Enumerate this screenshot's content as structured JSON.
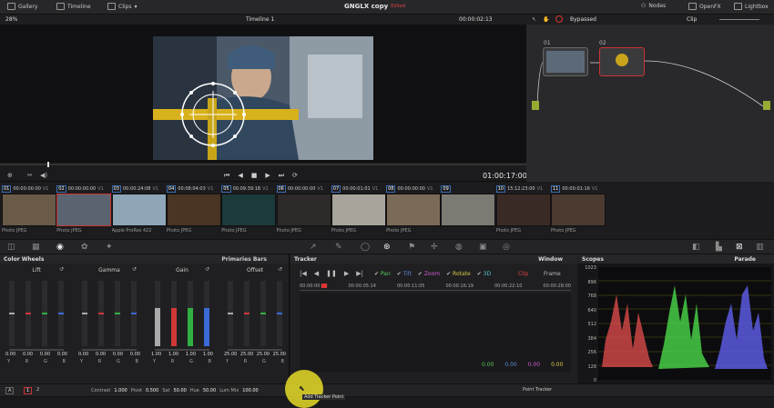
{
  "topbar": {
    "gallery": "Gallery",
    "timeline": "Timeline",
    "clips": "Clips",
    "project": "GNGLX copy",
    "edited": "Edited",
    "nodes": "Nodes",
    "openfx": "OpenFX",
    "lightbox": "Lightbox"
  },
  "viewer": {
    "zoom": "28%",
    "timeline_name": "Timeline 1",
    "timecode_top": "00:00:02:13",
    "timecode": "01:00:17:00"
  },
  "nodes": {
    "mode": "Bypassed",
    "clip": "Clip",
    "n1": "01",
    "n2": "02"
  },
  "clips": [
    {
      "num": "01",
      "tc": "00:00:00:00",
      "track": "V1",
      "name": "Photo JPEG",
      "c": "#6a5a48"
    },
    {
      "num": "02",
      "tc": "00:00:00:00",
      "track": "V1",
      "name": "Photo JPEG",
      "c": "#5a6470"
    },
    {
      "num": "03",
      "tc": "00:00:24:08",
      "track": "V1",
      "name": "Apple ProRes 422",
      "c": "#8ea6b8"
    },
    {
      "num": "04",
      "tc": "00:08:04:03",
      "track": "V1",
      "name": "Photo JPEG",
      "c": "#4a3424"
    },
    {
      "num": "05",
      "tc": "00:09:39:18",
      "track": "V1",
      "name": "Photo JPEG",
      "c": "#1c3a3c"
    },
    {
      "num": "06",
      "tc": "00:00:00:00",
      "track": "V1",
      "name": "Photo JPEG",
      "c": "#2e2a2a"
    },
    {
      "num": "07",
      "tc": "00:00:01:01",
      "track": "V1",
      "name": "Photo JPEG",
      "c": "#a8a49c"
    },
    {
      "num": "08",
      "tc": "00:00:00:00",
      "track": "V1",
      "name": "Photo JPEG",
      "c": "#7c6a58"
    },
    {
      "num": "09",
      "tc": "",
      "track": "",
      "name": "",
      "c": "#7d7a74"
    },
    {
      "num": "10",
      "tc": "15:12:23:00",
      "track": "V1",
      "name": "Photo JPEG",
      "c": "#3a2a26"
    },
    {
      "num": "11",
      "tc": "00:00:01:16",
      "track": "V1",
      "name": "Photo JPEG",
      "c": "#4a3a30"
    }
  ],
  "color_wheels": {
    "title": "Color Wheels",
    "mode": "Primaries Bars",
    "wheels": [
      {
        "name": "Lift",
        "values": [
          "0.00",
          "0.00",
          "0.00",
          "0.00"
        ]
      },
      {
        "name": "Gamma",
        "values": [
          "0.00",
          "0.00",
          "0.00",
          "0.00"
        ]
      },
      {
        "name": "Gain",
        "values": [
          "1.00",
          "1.00",
          "1.00",
          "1.00"
        ]
      },
      {
        "name": "Offset",
        "values": [
          "25.00",
          "25.00",
          "25.00",
          "25.00"
        ]
      }
    ],
    "channels": [
      "Y",
      "R",
      "G",
      "B"
    ]
  },
  "tracker": {
    "title": "Tracker",
    "window": "Window",
    "pan": "Pan",
    "tilt": "Tilt",
    "zoom": "Zoom",
    "rotate": "Rotate",
    "threed": "3D",
    "clip": "Clip",
    "frame": "Frame",
    "ruler": [
      "00:00:00:00",
      "00:00:05:14",
      "00:00:11:05",
      "00:00:16:19",
      "00:00:22:10",
      "00:00:28:00"
    ],
    "readouts": [
      "0.00",
      "0.00",
      "0.00",
      "0.00"
    ],
    "point_tracker": "Point Tracker",
    "add_point": "Add Tracker Point"
  },
  "scopes": {
    "title": "Scopes",
    "mode": "Parade",
    "ticks": [
      "1023",
      "896",
      "768",
      "640",
      "512",
      "384",
      "256",
      "128",
      "0"
    ]
  },
  "bottom": {
    "a": "A",
    "p1": "1",
    "p2": "2",
    "contrast_l": "Contrast",
    "contrast": "1.000",
    "pivot_l": "Pivot",
    "pivot": "0.500",
    "sat_l": "Sat",
    "sat": "50.00",
    "hue_l": "Hue",
    "hue": "50.00",
    "lummix_l": "Lum Mix",
    "lummix": "100.00"
  }
}
